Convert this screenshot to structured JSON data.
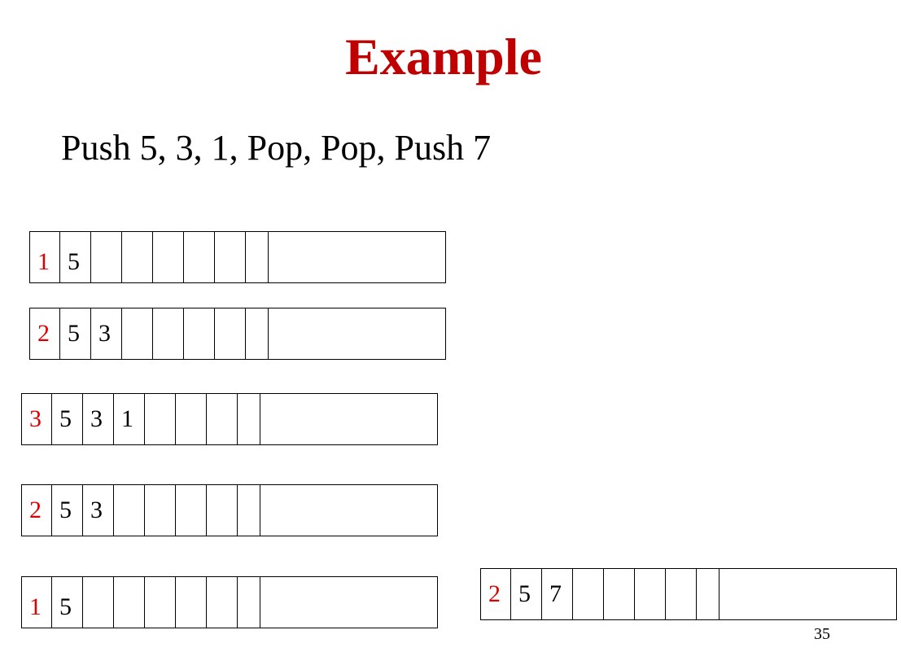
{
  "title": "Example",
  "subtitle": "Push 5, 3, 1, Pop, Pop, Push 7",
  "colors": {
    "title": "#c00000",
    "count": "#e00000"
  },
  "stacks": [
    {
      "count": "1",
      "values": [
        "5",
        "",
        "",
        "",
        "",
        "",
        ""
      ]
    },
    {
      "count": "2",
      "values": [
        "5",
        "3",
        "",
        "",
        "",
        "",
        ""
      ]
    },
    {
      "count": "3",
      "values": [
        "5",
        "3",
        "1",
        "",
        "",
        "",
        ""
      ]
    },
    {
      "count": "2",
      "values": [
        "5",
        "3",
        "",
        "",
        "",
        "",
        ""
      ]
    },
    {
      "count": "1",
      "values": [
        "5",
        "",
        "",
        "",
        "",
        "",
        ""
      ]
    },
    {
      "count": "2",
      "values": [
        "5",
        "7",
        "",
        "",
        "",
        "",
        ""
      ]
    }
  ],
  "page_number": "35"
}
